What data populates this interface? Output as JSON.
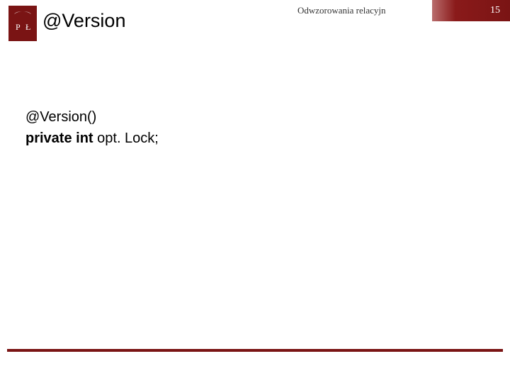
{
  "colors": {
    "brand": "#7a1414",
    "badge_gradient_start": "#b96d6d",
    "badge_gradient_end": "#7a1414"
  },
  "header": {
    "breadcrumb": "Odwzorowania relacyjn",
    "page_number": "15"
  },
  "logo": {
    "letters": "P Ł"
  },
  "title": "@Version",
  "body": {
    "line1": "@Version()",
    "line2_keyword": "private int",
    "line2_rest": " opt. Lock;"
  }
}
